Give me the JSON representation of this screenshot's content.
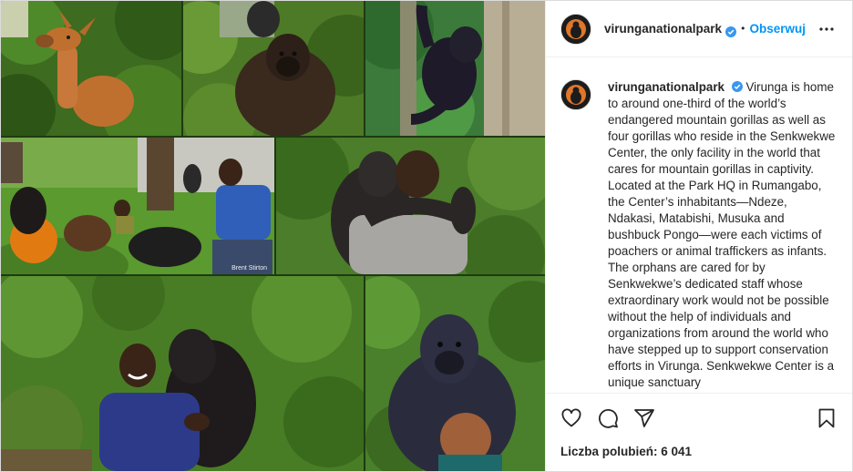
{
  "account": {
    "username": "virunganationalpark",
    "verified": true,
    "follow_label": "Obserwuj",
    "separator": "•"
  },
  "media": {
    "photo_credit": "Brent Stirton",
    "tiles": [
      {
        "subject": "bushbuck"
      },
      {
        "subject": "gorilla-sitting"
      },
      {
        "subject": "gorilla-climbing-tree"
      },
      {
        "subject": "caretakers-with-gorillas-and-ball"
      },
      {
        "subject": "caretaker-hugging-gorilla"
      },
      {
        "subject": "caretaker-smiling-with-gorilla"
      },
      {
        "subject": "gorilla-on-caretaker"
      }
    ]
  },
  "caption": {
    "username": "virunganationalpark",
    "text": "Virunga is home to around one-third of the world’s endangered mountain gorillas as well as four gorillas who reside in the Senkwekwe Center, the only facility in the world that cares for mountain gorillas in captivity. Located at the Park HQ in Rumangabo, the Center’s inhabitants—Ndeze, Ndakasi, Matabishi, Musuka and bushbuck Pongo—were each victims of poachers or animal traffickers as infants. The orphans are cared for by Senkwekwe’s dedicated staff whose extraordinary work would not be possible without the help of individuals and organizations from around the world who have stepped up to support conservation efforts in Virunga. Senkwekwe Center is a unique sanctuary"
  },
  "actions": {
    "icons": [
      "heart-icon",
      "comment-icon",
      "share-icon",
      "bookmark-icon"
    ]
  },
  "likes": {
    "label": "Liczba polubień: 6 041"
  },
  "colors": {
    "accent": "#0095f6",
    "text": "#262626",
    "border": "#dbdbdb"
  }
}
